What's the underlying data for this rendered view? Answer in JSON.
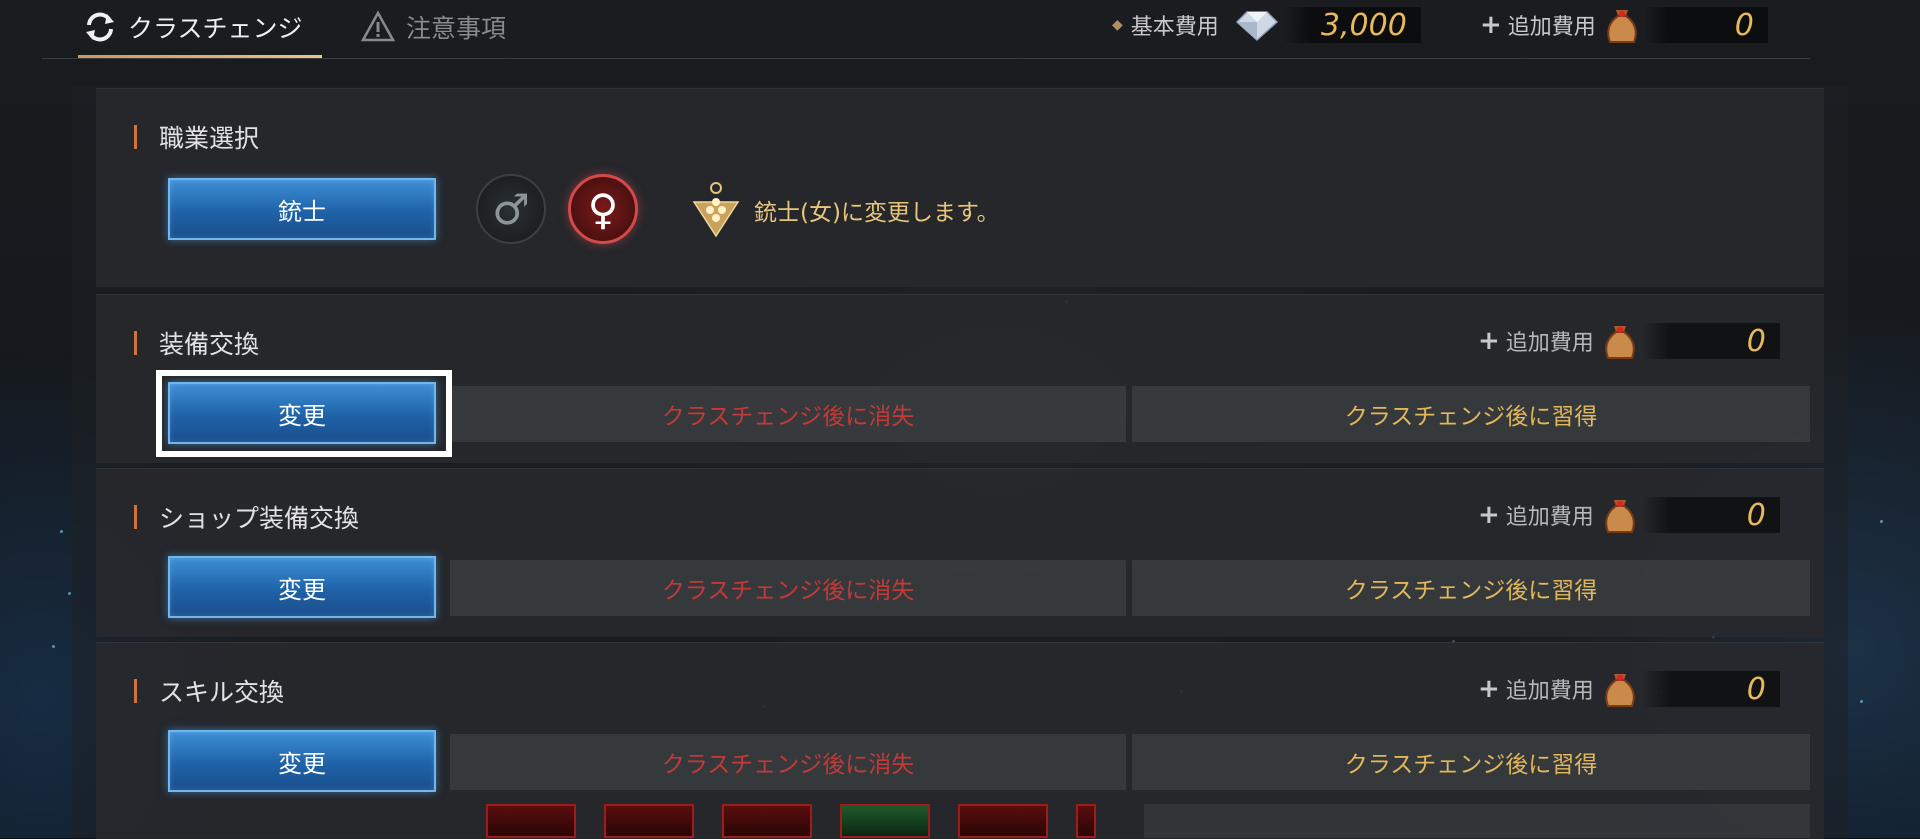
{
  "top_tabs": [
    {
      "label": "クラスチェンジ",
      "active": true,
      "icon": "refresh-icon"
    },
    {
      "label": "注意事項",
      "active": false,
      "icon": "warning-icon"
    }
  ],
  "costs": {
    "basic_label": "基本費用",
    "basic_value": "3,000",
    "basic_icon": "diamond-icon",
    "extra_label": "追加費用",
    "extra_value": "0",
    "extra_icon": "bag-icon"
  },
  "job_select": {
    "title": "職業選択",
    "job_button": "銃士",
    "male_symbol": "♂",
    "female_symbol": "♀",
    "selected_gender": "female",
    "note": "銃士(女)に変更します。"
  },
  "sections": [
    {
      "title": "装備交換",
      "button": "変更",
      "lose_label": "クラスチェンジ後に消失",
      "gain_label": "クラスチェンジ後に習得",
      "extra_label": "追加費用",
      "extra_value": "0"
    },
    {
      "title": "ショップ装備交換",
      "button": "変更",
      "lose_label": "クラスチェンジ後に消失",
      "gain_label": "クラスチェンジ後に習得",
      "extra_label": "追加費用",
      "extra_value": "0"
    },
    {
      "title": "スキル交換",
      "button": "変更",
      "lose_label": "クラスチェンジ後に消失",
      "gain_label": "クラスチェンジ後に習得",
      "extra_label": "追加費用",
      "extra_value": "0"
    }
  ],
  "colors": {
    "accent_orange": "#d2713b",
    "lose_red": "#c23a37",
    "gain_gold": "#e2b65a",
    "value_gold": "#e7b95b",
    "button_blue": "#1f62a8"
  }
}
